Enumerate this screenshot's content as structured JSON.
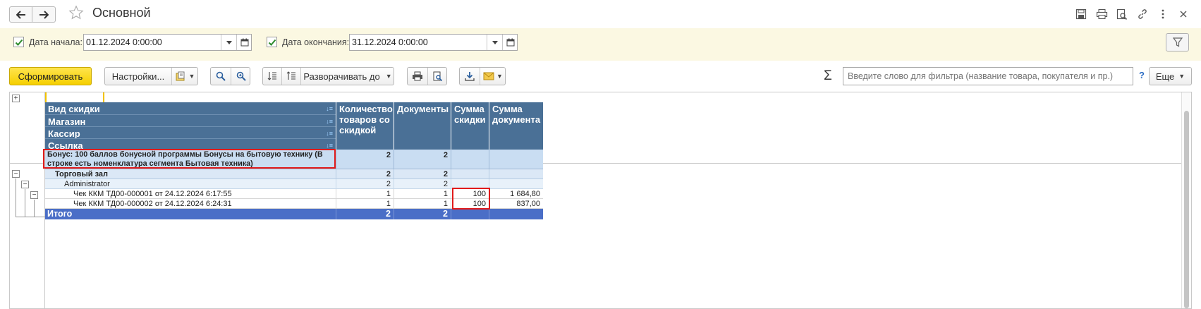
{
  "window": {
    "title": "Основной"
  },
  "toolbar_icons": [
    "save-icon",
    "print-icon",
    "preview-icon",
    "link-icon",
    "more-vertical-icon",
    "close-icon"
  ],
  "filters": {
    "start": {
      "label": "Дата начала:",
      "value": "01.12.2024  0:00:00",
      "checked": true
    },
    "end": {
      "label": "Дата окончания:",
      "value": "31.12.2024  0:00:00",
      "checked": true
    }
  },
  "actions": {
    "generate": "Сформировать",
    "settings": "Настройки...",
    "expand_to": "Разворачивать до",
    "more": "Еще",
    "search_placeholder": "Введите слово для фильтра (название товара, покупателя и пр.)",
    "help": "?"
  },
  "report": {
    "group_headers": [
      "Вид скидки",
      "Магазин",
      "Кассир",
      "Ссылка"
    ],
    "columns": [
      "Количество товаров со скидкой",
      "Документы",
      "Сумма скидки",
      "Сумма документа"
    ],
    "rows": [
      {
        "level": 0,
        "label": "Бонус: 100 баллов бонусной программы Бонусы на бытовую технику (В строке есть номенклатура сегмента Бытовая техника)",
        "qty": "2",
        "docs": "2",
        "discount": "",
        "total": ""
      },
      {
        "level": 1,
        "label": "Торговый зал",
        "qty": "2",
        "docs": "2",
        "discount": "",
        "total": ""
      },
      {
        "level": 2,
        "label": "Administrator",
        "qty": "2",
        "docs": "2",
        "discount": "",
        "total": ""
      },
      {
        "level": 3,
        "label": "Чек ККМ ТД00-000001 от 24.12.2024 6:17:55",
        "qty": "1",
        "docs": "1",
        "discount": "100",
        "total": "1 684,80"
      },
      {
        "level": 3,
        "label": "Чек ККМ ТД00-000002 от 24.12.2024 6:24:31",
        "qty": "1",
        "docs": "1",
        "discount": "100",
        "total": "837,00"
      }
    ],
    "total": {
      "label": "Итого",
      "qty": "2",
      "docs": "2",
      "discount": "",
      "total": ""
    }
  },
  "colors": {
    "header_bg": "#4a7096",
    "total_bg": "#4a6ec7",
    "level0_bg": "#c9ddf2",
    "level1_bg": "#dbe8f6",
    "level2_bg": "#e8f1fa",
    "highlight": "#e11b1b",
    "accent_button": "#f5cf00",
    "filter_bar": "#fbf8e2"
  }
}
